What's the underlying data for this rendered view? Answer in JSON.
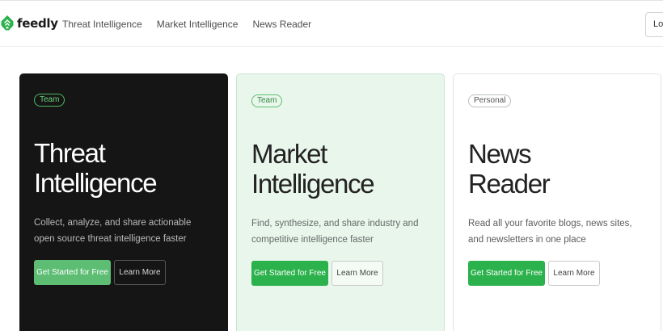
{
  "header": {
    "logo_text": "feedly",
    "nav": [
      "Threat Intelligence",
      "Market Intelligence",
      "News Reader"
    ],
    "login_label": "Log"
  },
  "cards": [
    {
      "badge": "Team",
      "title_line1": "Threat",
      "title_line2": "Intelligence",
      "description": "Collect, analyze, and share actionable open source threat intelligence faster",
      "primary_label": "Get Started for Free",
      "secondary_label": "Learn More"
    },
    {
      "badge": "Team",
      "title_line1": "Market",
      "title_line2": "Intelligence",
      "description": "Find, synthesize, and share industry and competitive intelligence faster",
      "primary_label": "Get Started for Free",
      "secondary_label": "Learn More"
    },
    {
      "badge": "Personal",
      "title_line1": "News",
      "title_line2": "Reader",
      "description": "Read all your favorite blogs, news sites, and newsletters in one place",
      "primary_label": "Get Started for Free",
      "secondary_label": "Learn More"
    }
  ],
  "colors": {
    "brand_green": "#2bb24c",
    "dark_card": "#151515",
    "market_card": "#e9f6ec"
  },
  "icons": {
    "logo": "feedly-logo-icon"
  }
}
